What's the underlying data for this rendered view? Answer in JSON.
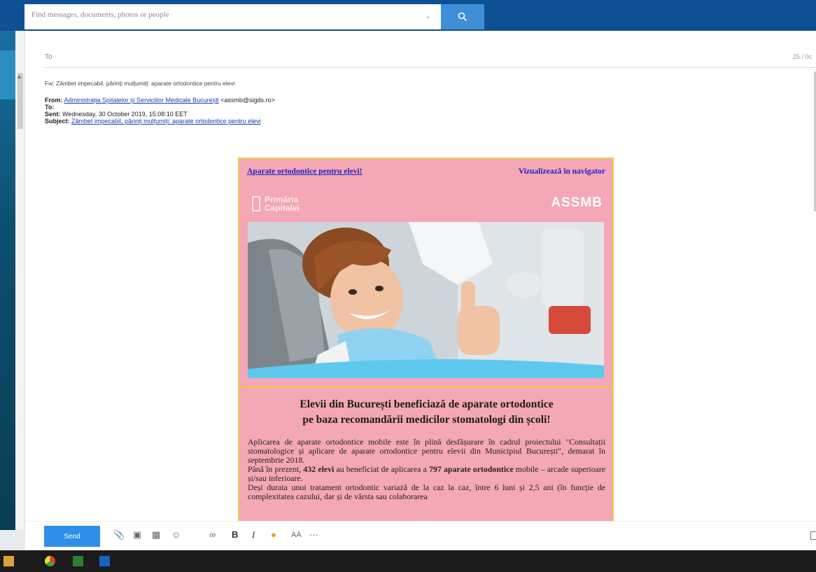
{
  "search": {
    "placeholder": "Find messages, documents, photos or people"
  },
  "compose": {
    "to_label": "To",
    "draft_status": "25 / 0c",
    "subject_line": "Fw: Zâmbet impecabil, părinți mulțumiți: aparate ortodontice pentru elevi"
  },
  "forwarded_header": {
    "from_label": "From:",
    "from_name": "Administrația Spitalelor și Serviciilor Medicale București",
    "from_email": "<assmb@sigds.ro>",
    "to_label": "To:",
    "sent_label": "Sent:",
    "sent_value": "Wednesday, 30 October 2019, 15:08:10 EET",
    "subject_label": "Subject:",
    "subject_value": "Zâmbet impecabil, părinți mulțumiți: aparate ortodontice pentru elevi"
  },
  "newsletter": {
    "link_left": "Aparate ortodontice pentru elevi!",
    "link_right": "Vizualizează în navigator",
    "logo_left": "Primăria Capitalei",
    "logo_right": "ASSMB",
    "headline_1": "Elevii din București beneficiază de aparate ortodontice",
    "headline_2": "pe baza recomandării medicilor stomatologi din școli!",
    "p1": "Aplicarea de aparate ortodontice mobile este în plină desfășurare în cadrul proiectului \"Consultații stomatologice și aplicare de aparate ortodontice pentru elevii din Municipiul București\", demarat în septembrie 2018.",
    "p2_a": "Până în prezent, ",
    "p2_b": "432 elevi",
    "p2_c": " au beneficiat de aplicarea a ",
    "p2_d": "797 aparate ortodontice",
    "p2_e": " mobile – arcade superioare și/sau inferioare.",
    "p3": "Deși durata unui tratament ortodontic variază de la caz la caz, între 6 luni și 2,5 ani (în funcție de complexitatea cazului, dar și de vârsta sau colaborarea"
  },
  "toolbar": {
    "send_label": "Send",
    "bold_label": "B",
    "italic_label": "I",
    "font_size_label": "AA",
    "more_label": "···"
  },
  "colors": {
    "topbar": "#0f4f93",
    "search_button": "#3f8ed8",
    "send_button": "#2d8fe8",
    "newsletter_bg": "#f4a7b4",
    "newsletter_border": "#f0c94a",
    "link": "#1d23c9"
  }
}
